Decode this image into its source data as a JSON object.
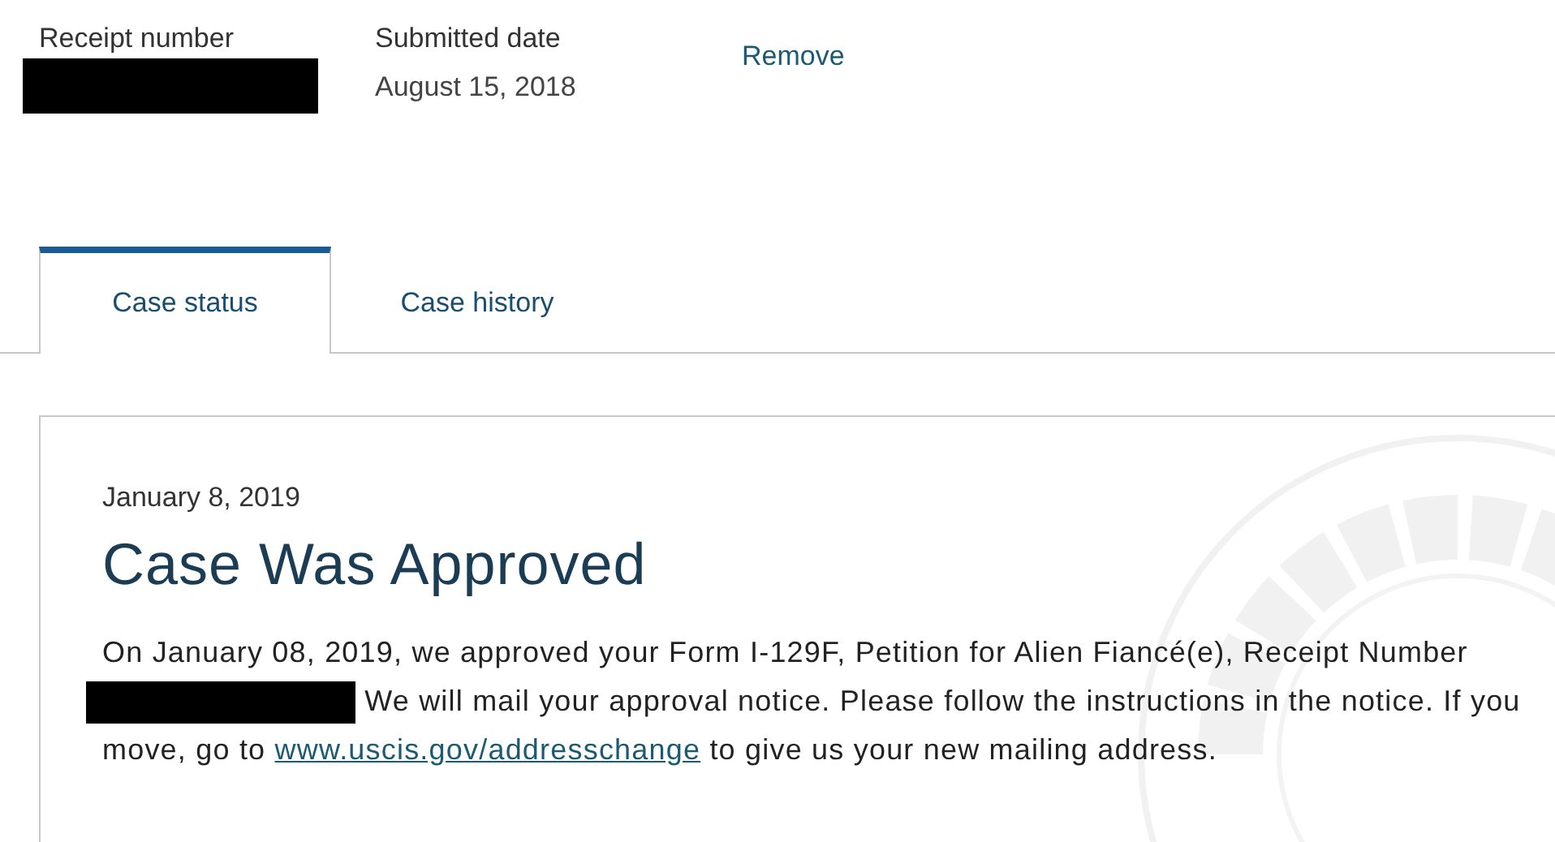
{
  "summary": {
    "receipt": {
      "label": "Receipt number",
      "redacted": true
    },
    "submitted": {
      "label": "Submitted date",
      "value": "August 15, 2018"
    },
    "remove_link": "Remove"
  },
  "tabs": [
    {
      "label": "Case status",
      "selected": true
    },
    {
      "label": "Case history",
      "selected": false
    }
  ],
  "status_card": {
    "date": "January 8, 2019",
    "title": "Case Was Approved",
    "body": [
      {
        "kind": "text",
        "text": "On January 08, 2019, we approved your Form I-129F, Petition for Alien Fiancé(e), Receipt Number "
      },
      {
        "kind": "redaction"
      },
      {
        "kind": "text",
        "text": " We will mail your approval notice. Please follow the instructions in the notice. If you move, go to "
      },
      {
        "kind": "link",
        "text": "www.uscis.gov/addresschange"
      },
      {
        "kind": "text",
        "text": " to give us your new mailing address."
      }
    ]
  }
}
